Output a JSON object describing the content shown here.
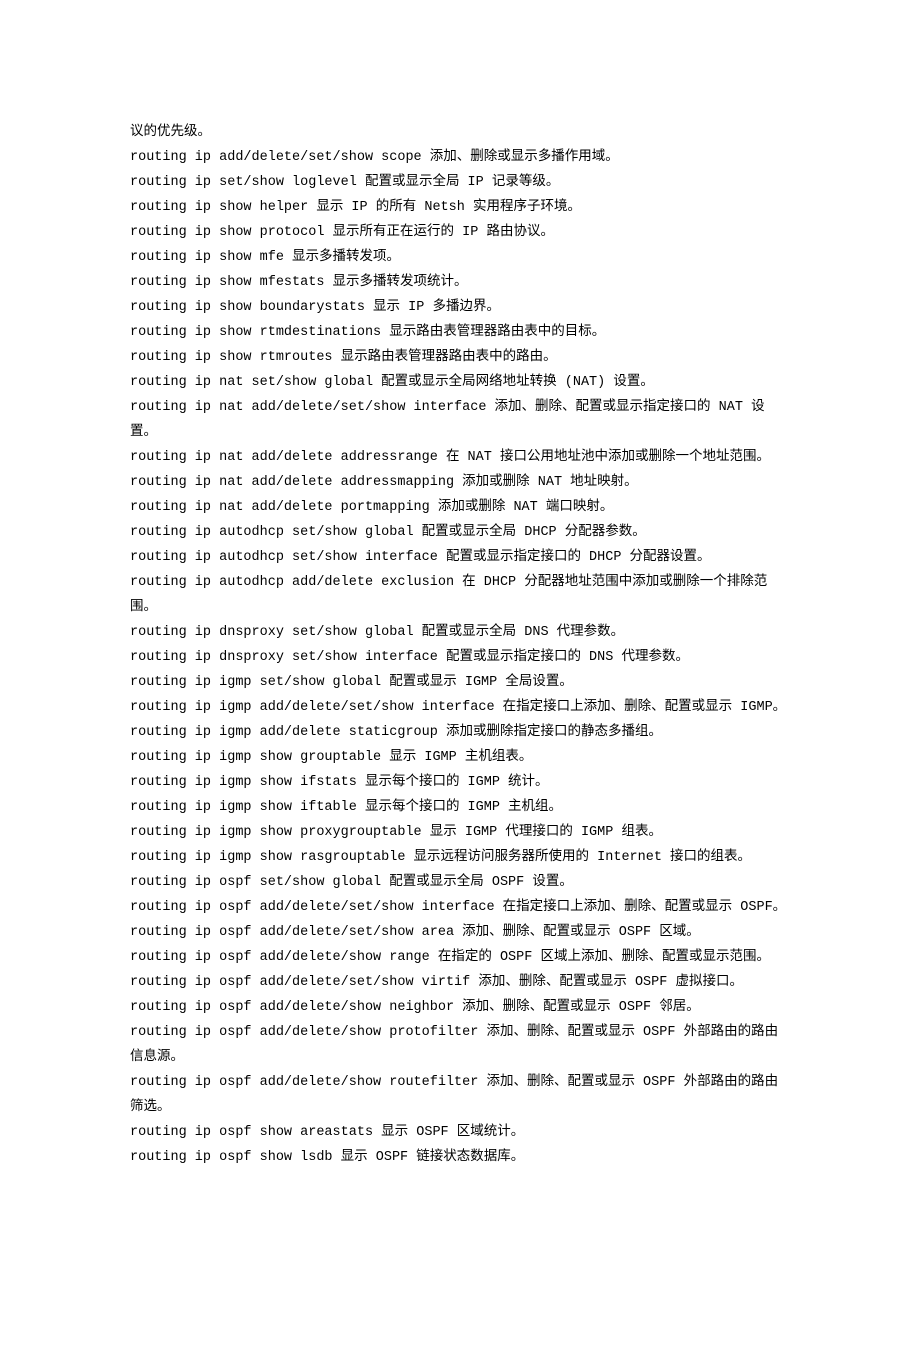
{
  "lines": [
    "议的优先级。",
    "routing ip add/delete/set/show scope 添加、删除或显示多播作用域。",
    "routing ip set/show loglevel 配置或显示全局 IP 记录等级。",
    "routing ip show helper 显示 IP 的所有 Netsh 实用程序子环境。",
    "routing ip show protocol 显示所有正在运行的 IP 路由协议。",
    "routing ip show mfe 显示多播转发项。",
    "routing ip show mfestats 显示多播转发项统计。",
    "routing ip show boundarystats 显示 IP 多播边界。",
    "routing ip show rtmdestinations 显示路由表管理器路由表中的目标。",
    "routing ip show rtmroutes 显示路由表管理器路由表中的路由。",
    "routing ip nat set/show global 配置或显示全局网络地址转换 (NAT) 设置。",
    "routing ip nat add/delete/set/show interface 添加、删除、配置或显示指定接口的 NAT 设置。",
    "routing ip nat add/delete addressrange 在 NAT 接口公用地址池中添加或删除一个地址范围。",
    "routing ip nat add/delete addressmapping 添加或删除 NAT 地址映射。",
    "routing ip nat add/delete portmapping 添加或删除 NAT 端口映射。",
    "routing ip autodhcp set/show global 配置或显示全局 DHCP 分配器参数。",
    "routing ip autodhcp set/show interface 配置或显示指定接口的 DHCP 分配器设置。",
    "routing ip autodhcp add/delete exclusion 在 DHCP 分配器地址范围中添加或删除一个排除范围。",
    "routing ip dnsproxy set/show global 配置或显示全局 DNS 代理参数。",
    "routing ip dnsproxy set/show interface 配置或显示指定接口的 DNS 代理参数。",
    "routing ip igmp set/show global 配置或显示 IGMP 全局设置。",
    "routing ip igmp add/delete/set/show interface 在指定接口上添加、删除、配置或显示 IGMP。",
    "routing ip igmp add/delete staticgroup 添加或删除指定接口的静态多播组。",
    "routing ip igmp show grouptable 显示 IGMP 主机组表。",
    "routing ip igmp show ifstats 显示每个接口的 IGMP 统计。",
    "routing ip igmp show iftable 显示每个接口的 IGMP 主机组。",
    "routing ip igmp show proxygrouptable 显示 IGMP 代理接口的 IGMP 组表。",
    "routing ip igmp show rasgrouptable 显示远程访问服务器所使用的 Internet 接口的组表。",
    "routing ip ospf set/show global 配置或显示全局 OSPF 设置。",
    "routing ip ospf add/delete/set/show interface 在指定接口上添加、删除、配置或显示 OSPF。",
    "routing ip ospf add/delete/set/show area 添加、删除、配置或显示 OSPF 区域。",
    "routing ip ospf add/delete/show range 在指定的 OSPF 区域上添加、删除、配置或显示范围。",
    "routing ip ospf add/delete/set/show virtif 添加、删除、配置或显示 OSPF 虚拟接口。",
    "routing ip ospf add/delete/show neighbor 添加、删除、配置或显示 OSPF 邻居。",
    "routing ip ospf add/delete/show protofilter 添加、删除、配置或显示 OSPF 外部路由的路由信息源。",
    "routing ip ospf add/delete/show routefilter 添加、删除、配置或显示 OSPF 外部路由的路由筛选。",
    "routing ip ospf show areastats 显示 OSPF 区域统计。",
    "routing ip ospf show lsdb 显示 OSPF 链接状态数据库。"
  ]
}
